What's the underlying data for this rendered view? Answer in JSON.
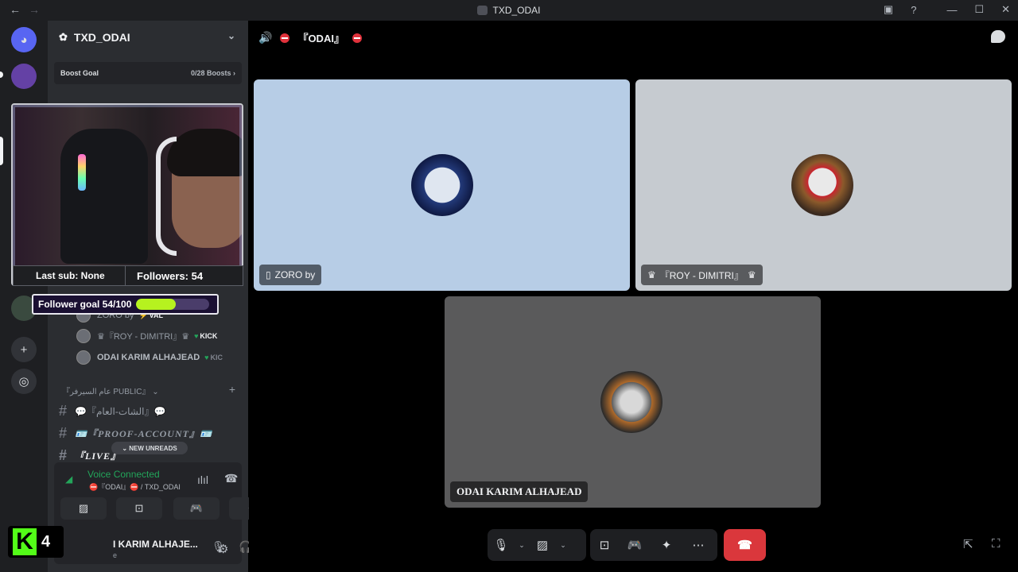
{
  "window": {
    "title": "TXD_ODAI",
    "back": "←",
    "forward": "→",
    "inbox_icon": "▣",
    "help_icon": "?",
    "minimize": "—",
    "maximize": "☐",
    "close": "✕"
  },
  "rail": {
    "discord_icon": "◕",
    "add_icon": "+",
    "explore_icon": "◎"
  },
  "guild": {
    "name": "TXD_ODAI",
    "boost_label": "Boost Goal",
    "boost_value": "0/28 Boosts ›"
  },
  "voice_members": [
    {
      "name": "ZORO by",
      "tag": "VAL"
    },
    {
      "name": "♛『ROY - DIMITRI』♛",
      "tag": "KICK"
    },
    {
      "name": "ODAI KARIM ALHAJEAD",
      "tag": "KIC"
    }
  ],
  "category": {
    "label": "『عام السيرفر PUBLIC』 ⌄",
    "plus": "+"
  },
  "channels": [
    {
      "hash": "#",
      "label": "💬『الشات-العام』💬"
    },
    {
      "hash": "#",
      "label": "🪪『PROOF-ACCOUNT』🪪"
    },
    {
      "hash": "#",
      "label": "『LIVE』"
    }
  ],
  "new_unreads": "⌄  NEW UNREADS",
  "voice_panel": {
    "status": "Voice Connected",
    "channel": "⛔『ODAI』⛔ / TXD_ODAI",
    "signal_icon": "◢",
    "soundboard_icon": "ılıl",
    "disconnect_icon": "☎"
  },
  "voice_buttons": [
    "▨",
    "⊡",
    "🎮",
    "✦"
  ],
  "user": {
    "name": "I KARIM ALHAJE...",
    "sub": "e",
    "mic_icon": "🎙",
    "headset_icon": "🎧",
    "settings_icon": "⚙"
  },
  "kick_overlay": {
    "logo": "K",
    "count": "4"
  },
  "stream_overlay": {
    "last_sub": "Last sub: None",
    "followers": "Followers: 54",
    "goal_label": "Follower goal 54/100",
    "goal_fraction": 0.54
  },
  "call": {
    "channel": "『ODAI』",
    "tiles": [
      {
        "name": "ZORO by",
        "icon": "▯"
      },
      {
        "name": "『ROY - DIMITRI』",
        "icon": "♛"
      },
      {
        "name": "ODAI KARIM ALHAJEAD",
        "icon": ""
      }
    ]
  },
  "controls": {
    "mic": "🎙",
    "caret": "⌄",
    "camera": "▨",
    "share": "⊡",
    "activity": "🎮",
    "soundboard": "✦",
    "more": "⋯",
    "hangup": "☎",
    "popout": "⇱",
    "fullscreen": "⛶"
  },
  "colors": {
    "tile1": "#b7cde6",
    "tile2": "#c6cbd0",
    "tile3": "#5a5a5b",
    "accent_green": "#23a55a",
    "hangup": "#da373c",
    "goal_fill": "#b6f21f"
  }
}
